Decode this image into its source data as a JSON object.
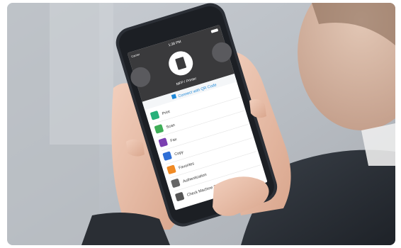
{
  "screen": {
    "status_time": "1:38 PM",
    "status_carrier": "Carrier",
    "device_label": "MFP / Printer",
    "connect_label": "Connect with QR Code",
    "menu": [
      {
        "label": "Print",
        "icon": "print-icon",
        "color": "#27b07a"
      },
      {
        "label": "Scan",
        "icon": "scan-icon",
        "color": "#3fae58"
      },
      {
        "label": "Fax",
        "icon": "fax-icon",
        "color": "#7b3fb0"
      },
      {
        "label": "Copy",
        "icon": "copy-icon",
        "color": "#2f6fd6"
      },
      {
        "label": "Favorites",
        "icon": "star-icon",
        "color": "#f08a24"
      },
      {
        "label": "Authentication",
        "icon": "gear-icon",
        "color": "#666666"
      },
      {
        "label": "Check Machine Status",
        "icon": "info-icon",
        "color": "#555555"
      }
    ]
  },
  "colors": {
    "app_header": "#3a3a3c",
    "accent": "#1e88d8",
    "phone_body": "#2b2f36"
  }
}
